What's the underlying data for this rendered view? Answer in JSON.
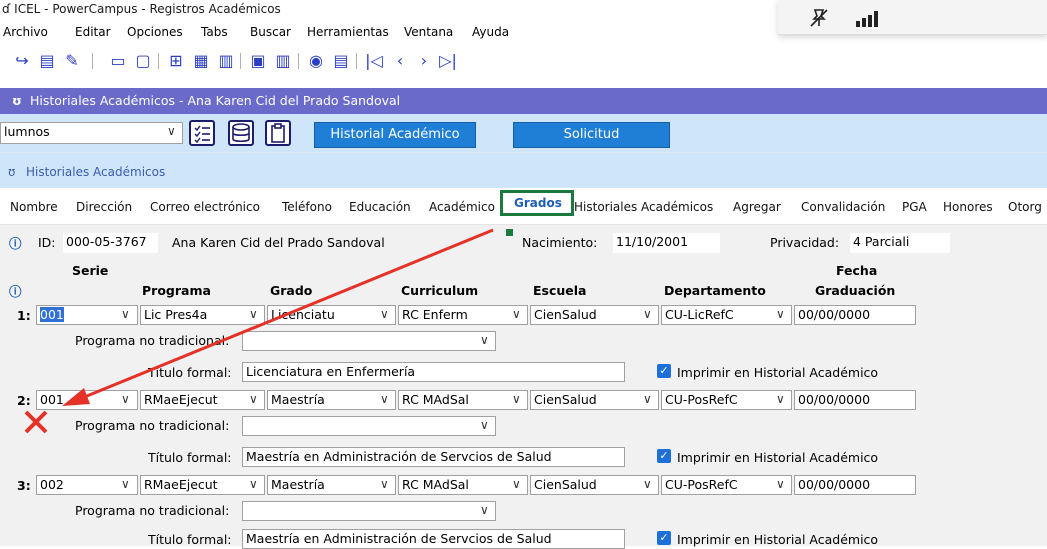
{
  "window": {
    "title": "ICEL - PowerCampus - Registros Académicos"
  },
  "menu": [
    "Archivo",
    "Editar",
    "Opciones",
    "Tabs",
    "Buscar",
    "Herramientas",
    "Ventana",
    "Ayuda"
  ],
  "header": {
    "title": "Historiales Académicos -  Ana Karen Cid del Prado Sandoval"
  },
  "toolbar2": {
    "selector_value": "lumnos",
    "historial_button": "Historial Académico",
    "solicitud_button": "Solicitud"
  },
  "section": {
    "title": "Historiales Académicos"
  },
  "tabs": [
    "Nombre",
    "Dirección",
    "Correo electrónico",
    "Teléfono",
    "Educación",
    "Académico",
    "Grados",
    "Historiales Académicos",
    "Agregar",
    "Convalidación",
    "PGA",
    "Honores",
    "Otorg"
  ],
  "active_tab": "Grados",
  "person": {
    "id_label": "ID:",
    "id": "000-05-3767",
    "name": "Ana Karen Cid del Prado Sandoval",
    "birth_label": "Nacimiento:",
    "birth": "11/10/2001",
    "privacy_label": "Privacidad:",
    "privacy": "4 Parciali"
  },
  "columns": {
    "serie": "Serie",
    "programa": "Programa",
    "grado": "Grado",
    "curriculum": "Curriculum",
    "escuela": "Escuela",
    "departamento": "Departamento",
    "fecha1": "Fecha",
    "fecha2": "Graduación"
  },
  "labels": {
    "no_tradicional": "Programa no tradicional:",
    "titulo_formal": "Título formal:",
    "imprimir": "Imprimir en Historial Académico"
  },
  "rows": [
    {
      "num": "1:",
      "serie": "001",
      "programa": "Lic Pres4a",
      "grado": "Licenciatu",
      "curriculum": "RC Enferm",
      "escuela": "CienSalud",
      "departamento": "CU-LicRefC",
      "fecha": "00/00/0000",
      "titulo": "Licenciatura en Enfermería"
    },
    {
      "num": "2:",
      "serie": "001",
      "programa": "RMaeEjecut",
      "grado": "Maestría",
      "curriculum": "RC MAdSal",
      "escuela": "CienSalud",
      "departamento": "CU-PosRefC",
      "fecha": "00/00/0000",
      "titulo": "Maestría en Administración de Servcios de Salud"
    },
    {
      "num": "3:",
      "serie": "002",
      "programa": "RMaeEjecut",
      "grado": "Maestría",
      "curriculum": "RC MAdSal",
      "escuela": "CienSalud",
      "departamento": "CU-PosRefC",
      "fecha": "00/00/0000",
      "titulo": "Maestría en Administración de Servcios de Salud"
    }
  ],
  "colors": {
    "header": "#6a6aca",
    "accent": "#1f7fd6",
    "highlight_box": "#1b7a3e",
    "arrow": "#e53228"
  }
}
